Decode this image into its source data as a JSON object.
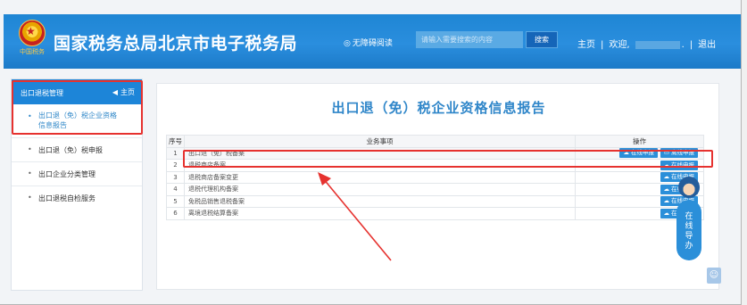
{
  "header": {
    "emblem_text": "中国税务",
    "site_title": "国家税务总局北京市电子税务局",
    "a11y_label": "无障碍阅读",
    "search_placeholder": "请输入需要搜索的内容",
    "search_button": "搜索",
    "nav_home": "主页",
    "nav_welcome": "欢迎,",
    "nav_logout": "退出"
  },
  "sidebar": {
    "title": "出口退税管理",
    "home_label": "主页",
    "items": [
      {
        "label_line1": "出口退（免）税企业资格",
        "label_line2": "信息报告",
        "active": true
      },
      {
        "label_line1": "出口退（免）税申报"
      },
      {
        "label_line1": "出口企业分类管理"
      },
      {
        "label_line1": "出口退税自检服务"
      }
    ]
  },
  "main": {
    "title": "出口退（免）税企业资格信息报告",
    "table": {
      "headers": [
        "序号",
        "业务事项",
        "操作"
      ],
      "rows": [
        {
          "num": "1",
          "name": "出口退（免）税备案",
          "ops": [
            "在线申报",
            "离线申报"
          ]
        },
        {
          "num": "2",
          "name": "退税商店备案",
          "ops": [
            "在线申报"
          ]
        },
        {
          "num": "3",
          "name": "退税商店备案变更",
          "ops": [
            "在线申报"
          ]
        },
        {
          "num": "4",
          "name": "退税代理机构备案",
          "ops": [
            "在线申报"
          ]
        },
        {
          "num": "5",
          "name": "免税品销售退税备案",
          "ops": [
            "在线申报"
          ]
        },
        {
          "num": "6",
          "name": "离境退税结算备案",
          "ops": [
            "在线申报"
          ]
        }
      ]
    }
  },
  "helper": {
    "label": "在线导办"
  },
  "icons": {
    "eye": "eye-icon",
    "home_arrow": "arrow-left-icon",
    "online_submit": "cloud-upload-icon",
    "offline_submit": "monitor-icon",
    "helper": "assistant-avatar-icon",
    "corner": "person-icon"
  },
  "colors": {
    "brand_blue": "#1f86d4",
    "title_blue": "#2f86c9",
    "button_blue": "#2b8fd9",
    "highlight_red": "#e6322f"
  }
}
